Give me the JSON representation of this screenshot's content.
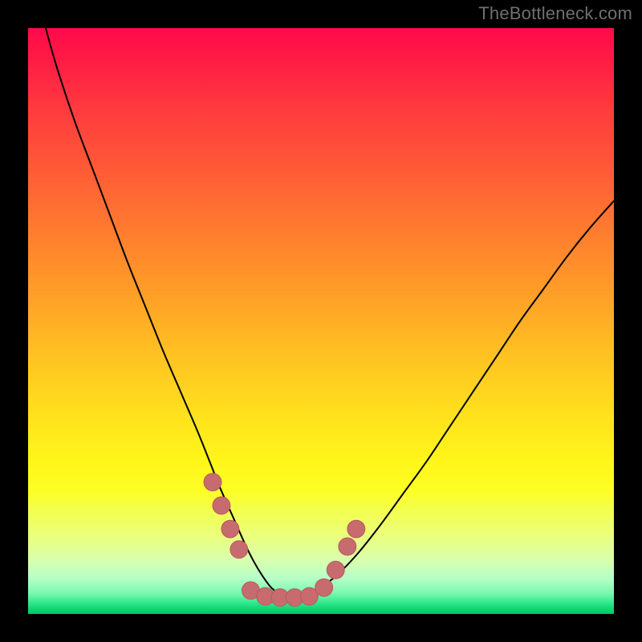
{
  "watermark": {
    "text": "TheBottleneck.com"
  },
  "colors": {
    "curve": "#000000",
    "marker_fill": "#c76b6f",
    "marker_stroke": "#b85a5e"
  },
  "chart_data": {
    "type": "line",
    "title": "",
    "xlabel": "",
    "ylabel": "",
    "xlim": [
      0,
      100
    ],
    "ylim": [
      0,
      100
    ],
    "grid": false,
    "legend": false,
    "series": [
      {
        "name": "bottleneck-curve",
        "x": [
          3,
          5,
          8,
          11,
          14,
          17,
          20,
          23,
          26,
          29,
          31,
          33,
          35,
          37,
          38.5,
          40,
          41.5,
          43,
          45,
          48,
          52,
          56,
          60,
          64,
          68,
          72,
          76,
          80,
          84,
          88,
          92,
          96,
          100
        ],
        "y": [
          100,
          93,
          84,
          76,
          68,
          60,
          52.5,
          45,
          38,
          31,
          26,
          21,
          16.5,
          12,
          9,
          6.5,
          4.5,
          3.5,
          3,
          3.5,
          6,
          10,
          15,
          20.5,
          26,
          32,
          38,
          44,
          50,
          55.5,
          61,
          66,
          70.5
        ]
      }
    ],
    "markers": [
      {
        "x": 31.5,
        "y": 22.5,
        "r": 1.5
      },
      {
        "x": 33.0,
        "y": 18.5,
        "r": 1.5
      },
      {
        "x": 34.5,
        "y": 14.5,
        "r": 1.5
      },
      {
        "x": 36.0,
        "y": 11.0,
        "r": 1.5
      },
      {
        "x": 38.0,
        "y": 4.0,
        "r": 1.5
      },
      {
        "x": 40.5,
        "y": 3.0,
        "r": 1.5
      },
      {
        "x": 43.0,
        "y": 2.8,
        "r": 1.5
      },
      {
        "x": 45.5,
        "y": 2.8,
        "r": 1.5
      },
      {
        "x": 48.0,
        "y": 3.0,
        "r": 1.5
      },
      {
        "x": 50.5,
        "y": 4.5,
        "r": 1.5
      },
      {
        "x": 52.5,
        "y": 7.5,
        "r": 1.5
      },
      {
        "x": 54.5,
        "y": 11.5,
        "r": 1.5
      },
      {
        "x": 56.0,
        "y": 14.5,
        "r": 1.5
      }
    ]
  }
}
